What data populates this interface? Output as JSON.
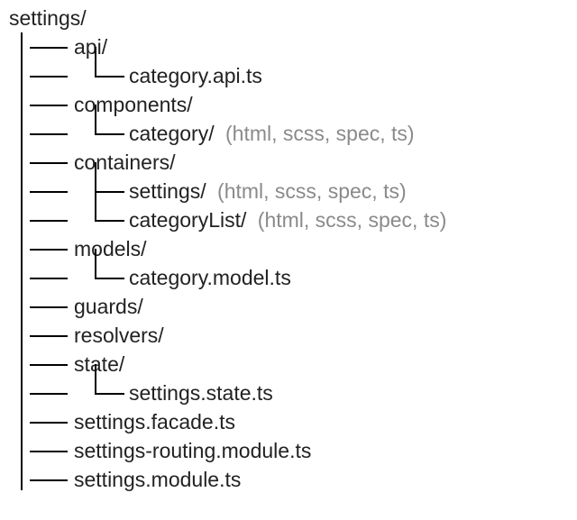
{
  "tree": {
    "root": "settings/",
    "api": "api/",
    "api_file": "category.api.ts",
    "components": "components/",
    "components_category": "category/",
    "containers": "containers/",
    "containers_settings": "settings/",
    "containers_categoryList": "categoryList/",
    "models": "models/",
    "models_file": "category.model.ts",
    "guards": "guards/",
    "resolvers": "resolvers/",
    "state": "state/",
    "state_file": "settings.state.ts",
    "facade": "settings.facade.ts",
    "routing": "settings-routing.module.ts",
    "module": "settings.module.ts",
    "note_files": "(html, scss, spec, ts)"
  }
}
